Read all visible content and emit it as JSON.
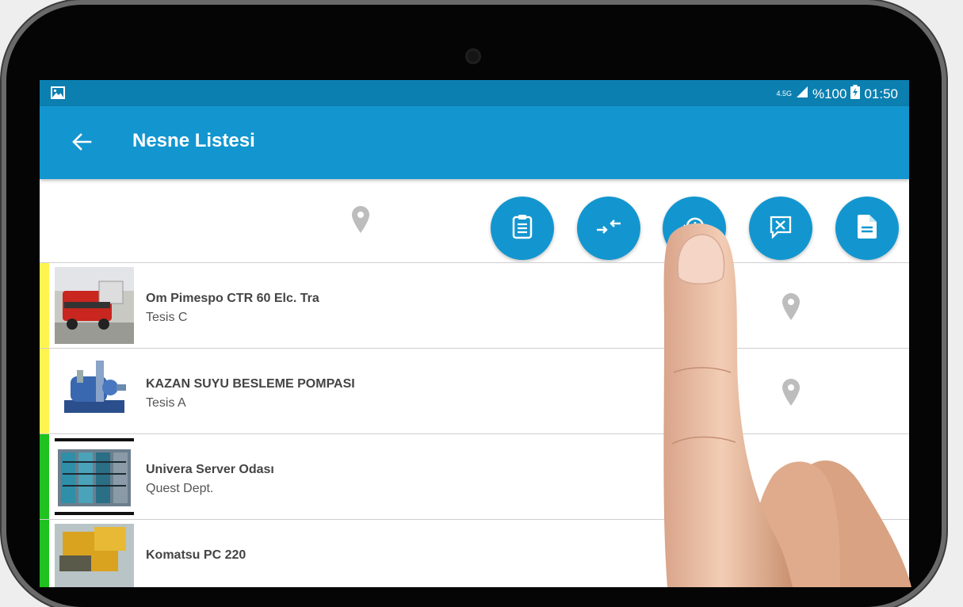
{
  "status_bar": {
    "network": "4.5G",
    "battery": "%100",
    "time": "01:50"
  },
  "app_bar": {
    "title": "Nesne Listesi",
    "back_icon": "arrow-left-icon"
  },
  "toolbar": {
    "location_icon": "map-pin-icon",
    "actions": [
      {
        "name": "clipboard-list",
        "icon": "clipboard-list-icon"
      },
      {
        "name": "transfer",
        "icon": "transfer-arrows-icon"
      },
      {
        "name": "history",
        "icon": "history-clock-icon"
      },
      {
        "name": "tools-message",
        "icon": "tools-message-icon"
      },
      {
        "name": "document",
        "icon": "document-icon"
      }
    ]
  },
  "items": [
    {
      "title": "Om Pimespo CTR 60 Elc. Tra",
      "subtitle": "Tesis C",
      "status_color": "#fff44f",
      "has_location": true
    },
    {
      "title": "KAZAN SUYU BESLEME POMPASI",
      "subtitle": "Tesis A",
      "status_color": "#fff44f",
      "has_location": true
    },
    {
      "title": "Univera Server Odası",
      "subtitle": "Quest Dept.",
      "status_color": "#1fc21f",
      "has_location": false
    },
    {
      "title": "Komatsu PC 220",
      "subtitle": "",
      "status_color": "#1fc21f",
      "has_location": false
    }
  ],
  "colors": {
    "primary": "#1396cf",
    "status_bar": "#0b7fb0",
    "yellow_status": "#fff44f",
    "green_status": "#1fc21f"
  }
}
